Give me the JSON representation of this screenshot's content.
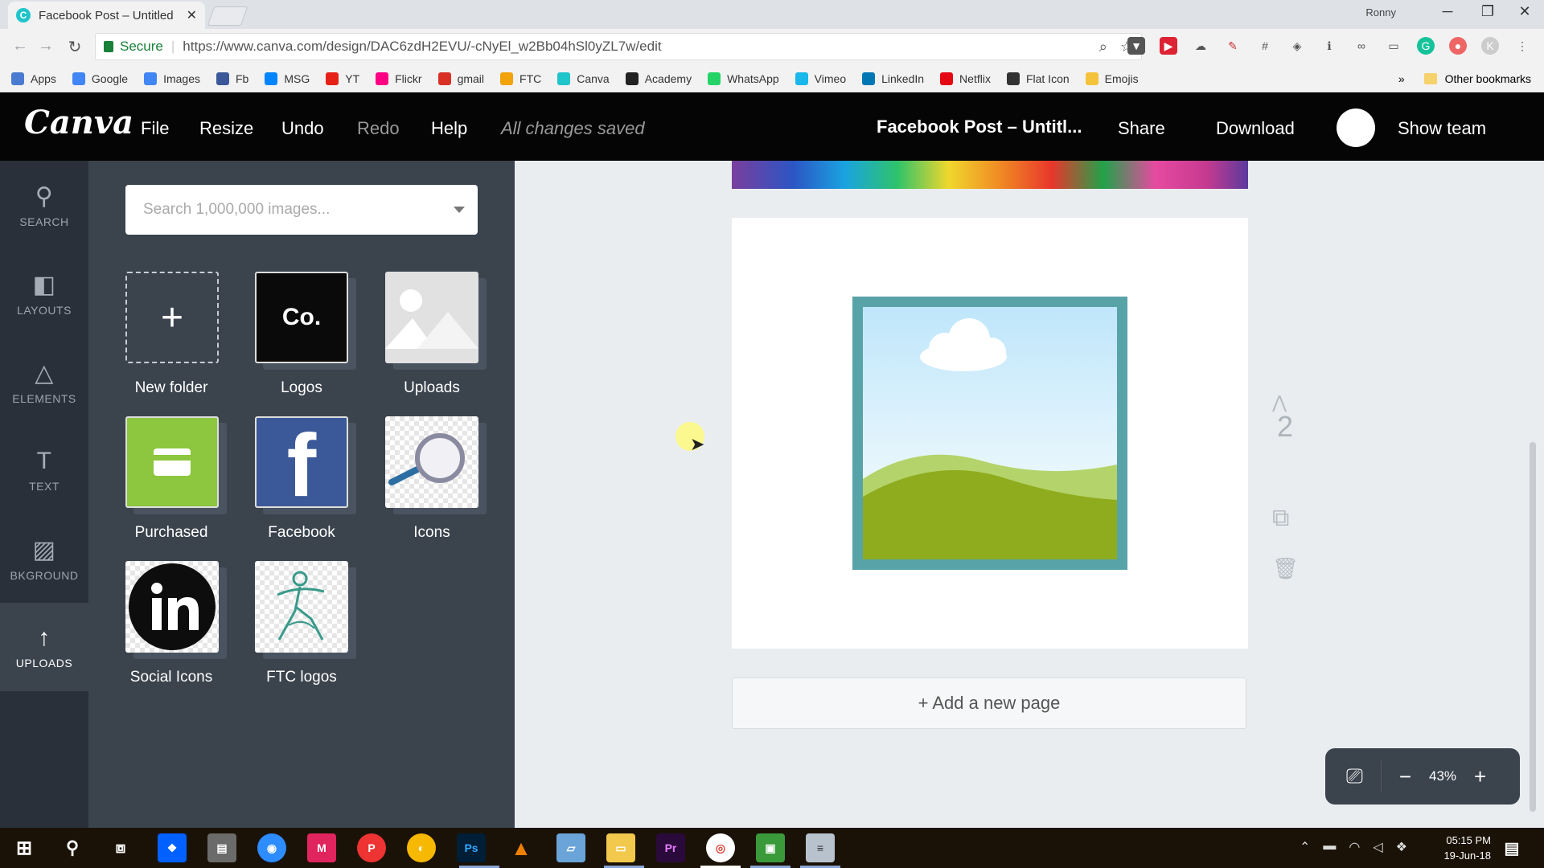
{
  "browser": {
    "tab_title": "Facebook Post – Untitled",
    "profile_name": "Ronny",
    "secure_label": "Secure",
    "url": "https://www.canva.com/design/DAC6zdH2EVU/-cNyEl_w2Bb04hSl0yZL7w/edit",
    "bookmarks": [
      {
        "label": "Apps",
        "color": "#4a7bd0"
      },
      {
        "label": "Google",
        "color": "#4285f4"
      },
      {
        "label": "Images",
        "color": "#4285f4"
      },
      {
        "label": "Fb",
        "color": "#3b5998"
      },
      {
        "label": "MSG",
        "color": "#0084ff"
      },
      {
        "label": "YT",
        "color": "#e62117"
      },
      {
        "label": "Flickr",
        "color": "#ff0084"
      },
      {
        "label": "gmail",
        "color": "#d93025"
      },
      {
        "label": "FTC",
        "color": "#f2a20b"
      },
      {
        "label": "Canva",
        "color": "#20c4cb"
      },
      {
        "label": "Academy",
        "color": "#222222"
      },
      {
        "label": "WhatsApp",
        "color": "#25d366"
      },
      {
        "label": "Vimeo",
        "color": "#1ab7ea"
      },
      {
        "label": "LinkedIn",
        "color": "#0077b5"
      },
      {
        "label": "Netflix",
        "color": "#e50914"
      },
      {
        "label": "Flat Icon",
        "color": "#333333"
      },
      {
        "label": "Emojis",
        "color": "#f5c33b"
      }
    ],
    "bookmarks_more": "»",
    "other_bookmarks": "Other bookmarks"
  },
  "header": {
    "logo": "Canva",
    "menu": {
      "file": "File",
      "resize": "Resize",
      "undo": "Undo",
      "redo": "Redo",
      "help": "Help"
    },
    "status": "All changes saved",
    "doc_title": "Facebook Post – Untitl...",
    "share": "Share",
    "download": "Download",
    "show_team": "Show team"
  },
  "rail": {
    "search": "SEARCH",
    "layouts": "LAYOUTS",
    "elements": "ELEMENTS",
    "text": "TEXT",
    "background": "BKGROUND",
    "uploads": "UPLOADS"
  },
  "panel": {
    "search_placeholder": "Search 1,000,000 images...",
    "folders": {
      "new_folder": "New folder",
      "logos": "Logos",
      "logos_thumb": "Co.",
      "uploads": "Uploads",
      "purchased": "Purchased",
      "facebook": "Facebook",
      "icons": "Icons",
      "social_icons": "Social Icons",
      "ftc_logos": "FTC logos"
    }
  },
  "canvas": {
    "page_number": "2",
    "add_page": "+ Add a new page",
    "zoom": "43%"
  },
  "taskbar": {
    "time": "05:15 PM",
    "date": "19-Jun-18"
  },
  "colors": {
    "canva_teal": "#20c4cb",
    "header_bg": "#050505",
    "panel_bg": "#3b434d",
    "rail_bg": "#293039",
    "frame": "#58a3a8",
    "purchased_green": "#8dc63f",
    "facebook_blue": "#3b5998"
  }
}
